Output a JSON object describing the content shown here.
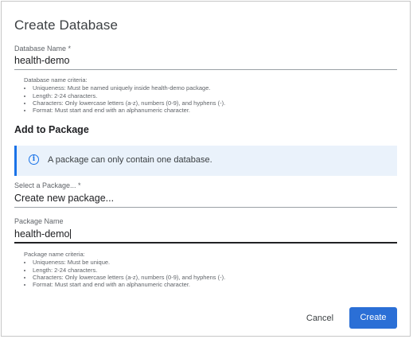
{
  "dialog": {
    "title": "Create Database",
    "database_name": {
      "label": "Database Name *",
      "value": "health-demo",
      "criteria_title": "Database name criteria:",
      "criteria": [
        "Uniqueness: Must be named uniquely inside health-demo package.",
        "Length: 2-24 characters.",
        "Characters: Only lowercase letters (a-z), numbers (0-9), and hyphens (-).",
        "Format: Must start and end with an alphanumeric character."
      ]
    },
    "package_section": {
      "heading": "Add to Package",
      "info_icon": "info-circle-icon",
      "info_text": "A package can only contain one database.",
      "select_label": "Select a Package... *",
      "select_value": "Create new package..."
    },
    "package_name": {
      "label": "Package Name",
      "value": "health-demo",
      "criteria_title": "Package name criteria:",
      "criteria": [
        "Uniqueness: Must be unique.",
        "Length: 2-24 characters.",
        "Characters: Only lowercase letters (a-z), numbers (0-9), and hyphens (-).",
        "Format: Must start and end with an alphanumeric character."
      ]
    },
    "buttons": {
      "cancel": "Cancel",
      "create": "Create"
    },
    "colors": {
      "accent": "#2b6fd6",
      "info_bg": "#eaf2fb",
      "info_border": "#1a73e8"
    }
  }
}
